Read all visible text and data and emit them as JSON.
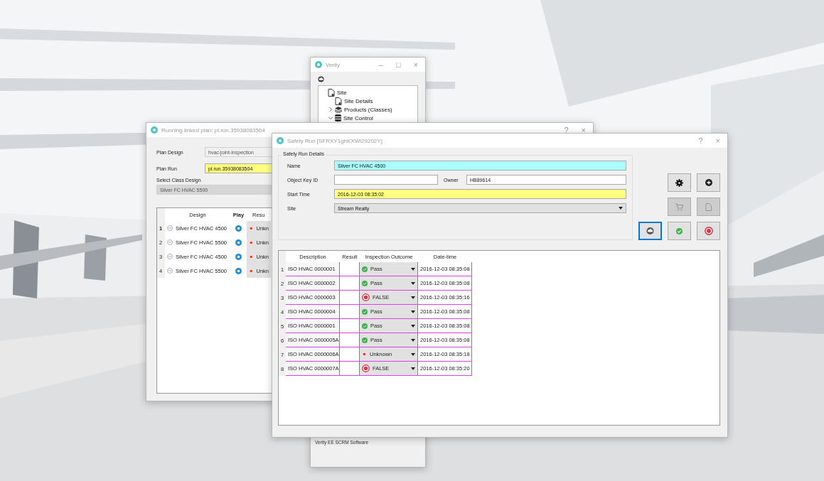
{
  "verity_window": {
    "title": "Verity",
    "controls": [
      "–",
      "□",
      "×"
    ],
    "tree": [
      {
        "label": "Site",
        "kind": "document",
        "children": [
          {
            "label": "Site Details",
            "kind": "document"
          },
          {
            "label": "Products (Classes)",
            "kind": "layers",
            "expanded": false
          },
          {
            "label": "Site Control",
            "kind": "database",
            "expanded": true
          }
        ]
      }
    ],
    "footer": "Verity EE SCRM Software"
  },
  "plan_window": {
    "title": "Running linked plan: pl.run.35938083504",
    "controls": [
      "?",
      "×"
    ],
    "plan_design": {
      "label": "Plan Design",
      "value": "hvac-joint-inspection"
    },
    "plan_run": {
      "label": "Plan Run",
      "value": "pl.run.35938083504"
    },
    "class_design": {
      "label": "Select Class Design",
      "value": "Silver FC HVAC 5500",
      "disabled": true
    },
    "table": {
      "columns": [
        "Design",
        "Play",
        "Resu"
      ],
      "rows": [
        {
          "index": "1",
          "design": "Silver FC HVAC 4500",
          "result": "Unkn"
        },
        {
          "index": "2",
          "design": "Silver FC HVAC 5500",
          "result": "Unkn"
        },
        {
          "index": "3",
          "design": "Silver FC HVAC 4500",
          "result": "Unkn"
        },
        {
          "index": "4",
          "design": "Silver FC HVAC 5500",
          "result": "Unkn"
        }
      ]
    }
  },
  "safety_window": {
    "title": "Safety Run [SFRXY1ghKXWi29202Y]",
    "controls": [
      "?",
      "×"
    ],
    "details": {
      "title": "Safety Run Details",
      "fields": [
        {
          "kind": "text",
          "label": "Name",
          "value": "Silver FC HVAC 4500",
          "color": "#aaffff"
        },
        {
          "kind": "pair",
          "label": "Object Key ID",
          "second_label": "Owner",
          "second_value": "HB89614",
          "color": "#ffffff"
        },
        {
          "kind": "text",
          "label": "Start Time",
          "value": "2016-12-03 08:35:02",
          "color": "#ffff80"
        },
        {
          "kind": "combo",
          "label": "Site",
          "value": "Stream Realty",
          "color": "#e1e1e1"
        }
      ]
    },
    "button_rows": [
      [
        {
          "kind": "gear",
          "disabled": false,
          "focused": false
        },
        {
          "kind": "add",
          "disabled": false,
          "focused": false
        }
      ],
      [
        {
          "kind": "cart",
          "disabled": true,
          "focused": false
        },
        {
          "kind": "document",
          "disabled": true,
          "focused": false
        }
      ],
      [
        {
          "kind": "cloud",
          "disabled": false,
          "focused": true
        },
        {
          "kind": "check",
          "disabled": false,
          "focused": false
        },
        {
          "kind": "record",
          "disabled": false,
          "focused": false
        }
      ]
    ],
    "table": {
      "columns": [
        "Description",
        "Result",
        "Inspection Outcome",
        "Date-time"
      ],
      "rows": [
        {
          "index": "1",
          "description": "ISO HVAC 0000001",
          "outcome": {
            "kind": "pass",
            "label": "Pass"
          },
          "datetime": "2016-12-03 08:35:08"
        },
        {
          "index": "2",
          "description": "ISO HVAC 0000002",
          "outcome": {
            "kind": "pass",
            "label": "Pass"
          },
          "datetime": "2016-12-03 08:35:08"
        },
        {
          "index": "3",
          "description": "ISO HVAC 0000003",
          "outcome": {
            "kind": "fail",
            "label": "FALSE"
          },
          "datetime": "2016-12-03 08:35:16"
        },
        {
          "index": "4",
          "description": "ISO HVAC 0000004",
          "outcome": {
            "kind": "pass",
            "label": "Pass"
          },
          "datetime": "2016-12-03 08:35:08"
        },
        {
          "index": "5",
          "description": "ISO HVAC 0000001",
          "outcome": {
            "kind": "pass",
            "label": "Pass"
          },
          "datetime": "2016-12-03 08:35:08"
        },
        {
          "index": "6",
          "description": "ISO HVAC 0000005A",
          "outcome": {
            "kind": "pass",
            "label": "Pass"
          },
          "datetime": "2016-12-03 08:35:08"
        },
        {
          "index": "7",
          "description": "ISO HVAC 0000006A",
          "outcome": {
            "kind": "unknown",
            "label": "Unknown"
          },
          "datetime": "2016-12-03 08:35:18"
        },
        {
          "index": "8",
          "description": "ISO HVAC 0000007A",
          "outcome": {
            "kind": "fail",
            "label": "FALSE"
          },
          "datetime": "2016-12-03 08:35:20"
        }
      ]
    }
  }
}
